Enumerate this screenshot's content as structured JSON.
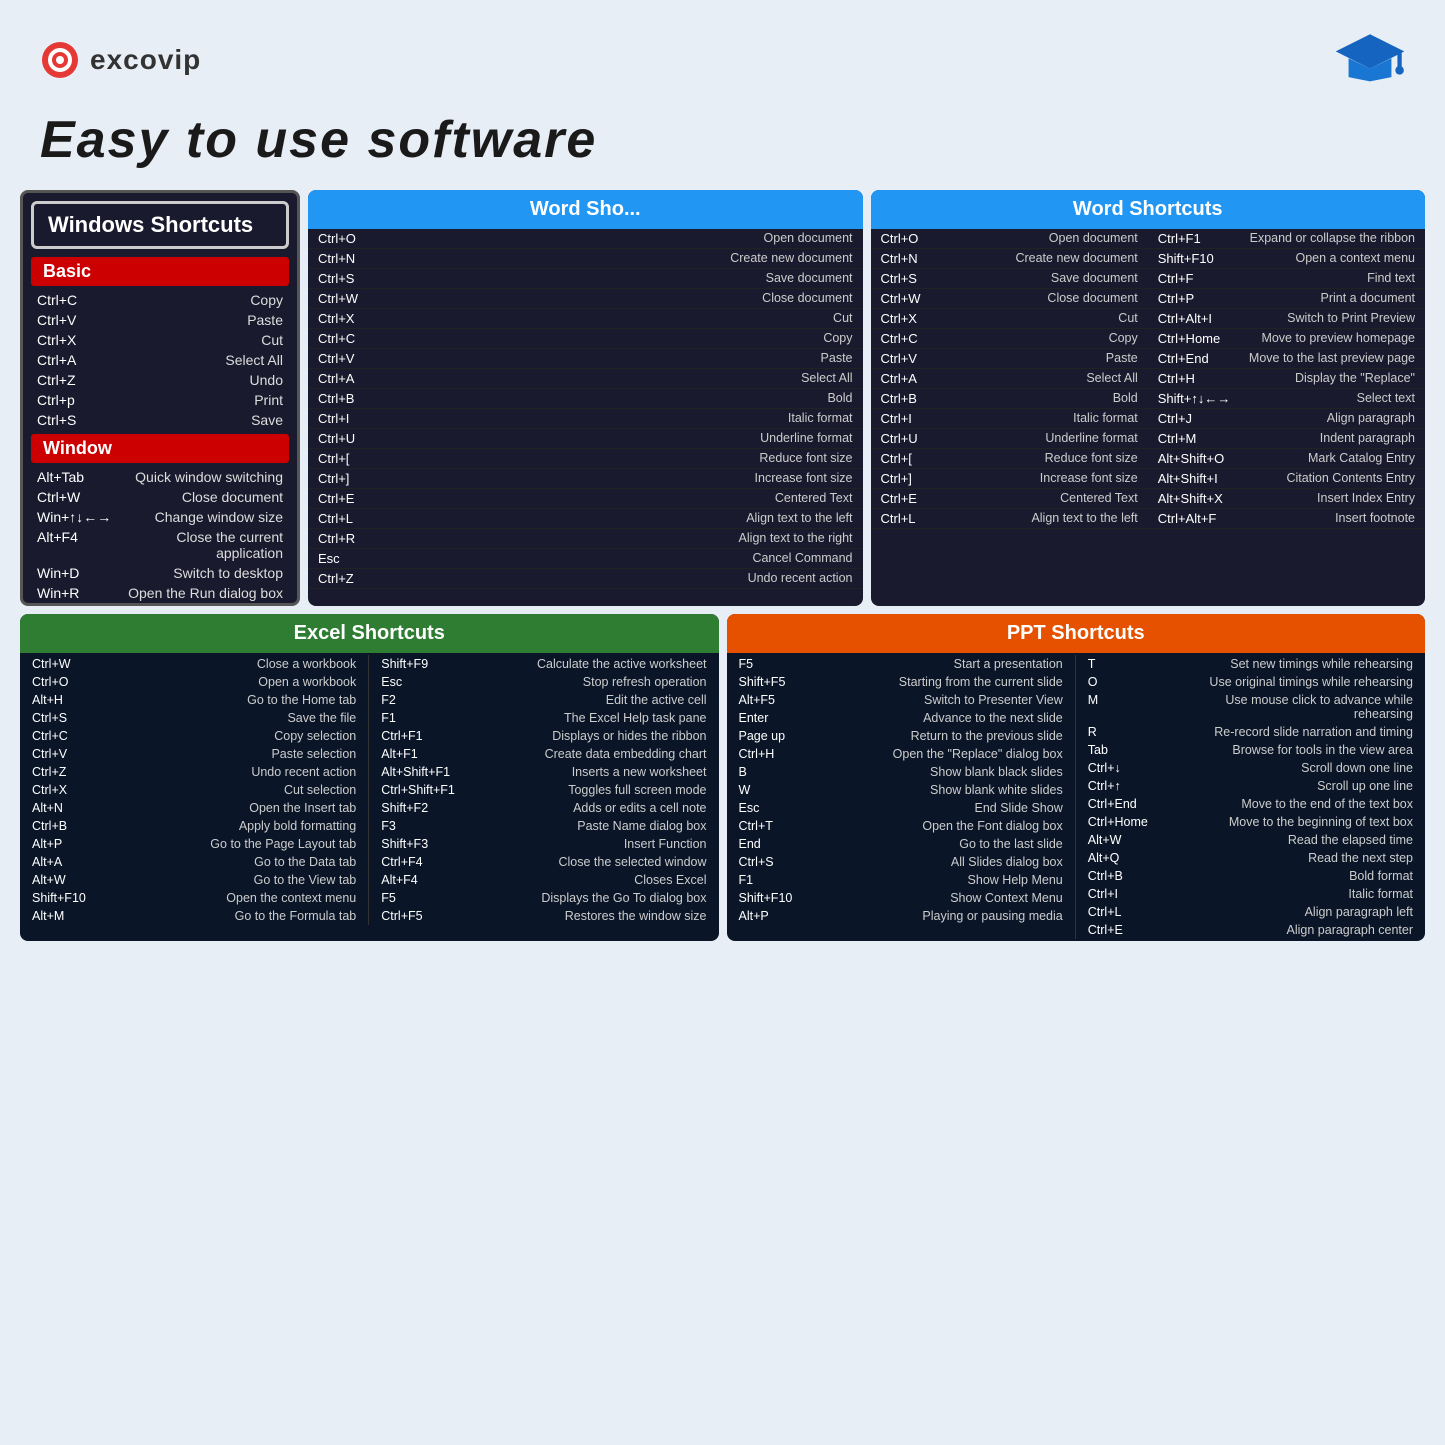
{
  "header": {
    "logo_text": "excovip",
    "tagline": "Easy to use software"
  },
  "windows": {
    "title": "Windows Shortcuts",
    "basic_label": "Basic",
    "basic_shortcuts": [
      {
        "key": "Ctrl+C",
        "desc": "Copy"
      },
      {
        "key": "Ctrl+V",
        "desc": "Paste"
      },
      {
        "key": "Ctrl+X",
        "desc": "Cut"
      },
      {
        "key": "Ctrl+A",
        "desc": "Select All"
      },
      {
        "key": "Ctrl+Z",
        "desc": "Undo"
      },
      {
        "key": "Ctrl+p",
        "desc": "Print"
      },
      {
        "key": "Ctrl+S",
        "desc": "Save"
      }
    ],
    "window_label": "Window",
    "window_shortcuts": [
      {
        "key": "Alt+Tab",
        "desc": "Quick window switching"
      },
      {
        "key": "Ctrl+W",
        "desc": "Close document"
      },
      {
        "key": "Win+↑↓←→",
        "desc": "Change window size"
      },
      {
        "key": "Alt+F4",
        "desc": "Close the current application"
      },
      {
        "key": "Win+D",
        "desc": "Switch to desktop"
      },
      {
        "key": "Win+R",
        "desc": "Open the Run dialog box"
      }
    ]
  },
  "word_left": {
    "title": "Word Sho...",
    "shortcuts": [
      {
        "key": "Ctrl+O",
        "desc": "Open document"
      },
      {
        "key": "Ctrl+N",
        "desc": "Create new document"
      },
      {
        "key": "Ctrl+S",
        "desc": "Save document"
      },
      {
        "key": "Ctrl+W",
        "desc": "Close document"
      },
      {
        "key": "Ctrl+X",
        "desc": "Cut"
      },
      {
        "key": "Ctrl+C",
        "desc": "Copy"
      },
      {
        "key": "Ctrl+V",
        "desc": "Paste"
      },
      {
        "key": "Ctrl+A",
        "desc": "Select All"
      },
      {
        "key": "Ctrl+B",
        "desc": "Bold"
      },
      {
        "key": "Ctrl+I",
        "desc": "Italic format"
      },
      {
        "key": "Ctrl+U",
        "desc": "Underline format"
      },
      {
        "key": "Ctrl+[",
        "desc": "Reduce font size"
      },
      {
        "key": "Ctrl+]",
        "desc": "Increase font size"
      },
      {
        "key": "Ctrl+E",
        "desc": "Centered Text"
      },
      {
        "key": "Ctrl+L",
        "desc": "Align text to the left"
      },
      {
        "key": "Ctrl+R",
        "desc": "Align text to the right"
      },
      {
        "key": "Esc",
        "desc": "Cancel Command"
      },
      {
        "key": "Ctrl+Z",
        "desc": "Undo recent action"
      }
    ]
  },
  "word_right": {
    "title": "Word Shortcuts",
    "col1": [
      {
        "key": "Ctrl+O",
        "desc": "Open document"
      },
      {
        "key": "Ctrl+N",
        "desc": "Create new document"
      },
      {
        "key": "Ctrl+S",
        "desc": "Save document"
      },
      {
        "key": "Ctrl+W",
        "desc": "Close document"
      },
      {
        "key": "Ctrl+X",
        "desc": "Cut"
      },
      {
        "key": "Ctrl+C",
        "desc": "Copy"
      },
      {
        "key": "Ctrl+V",
        "desc": "Paste"
      },
      {
        "key": "Ctrl+A",
        "desc": "Select All"
      },
      {
        "key": "Ctrl+B",
        "desc": "Bold"
      },
      {
        "key": "Ctrl+I",
        "desc": "Italic format"
      },
      {
        "key": "Ctrl+U",
        "desc": "Underline format"
      },
      {
        "key": "Ctrl+[",
        "desc": "Reduce font size"
      },
      {
        "key": "Ctrl+]",
        "desc": "Increase font size"
      },
      {
        "key": "Ctrl+E",
        "desc": "Centered Text"
      },
      {
        "key": "Ctrl+L",
        "desc": "Align text to the left"
      }
    ],
    "col2": [
      {
        "key": "Ctrl+F1",
        "desc": "Expand or collapse the ribbon"
      },
      {
        "key": "Shift+F10",
        "desc": "Open a context menu"
      },
      {
        "key": "Ctrl+F",
        "desc": "Find text"
      },
      {
        "key": "Ctrl+P",
        "desc": "Print a document"
      },
      {
        "key": "Ctrl+Alt+I",
        "desc": "Switch to Print Preview"
      },
      {
        "key": "Ctrl+Home",
        "desc": "Move to preview homepage"
      },
      {
        "key": "Ctrl+End",
        "desc": "Move to the last preview page"
      },
      {
        "key": "Ctrl+H",
        "desc": "Display the \"Replace\""
      },
      {
        "key": "Shift+↑↓←→",
        "desc": "Select text"
      },
      {
        "key": "Ctrl+J",
        "desc": "Align paragraph"
      },
      {
        "key": "Ctrl+M",
        "desc": "Indent paragraph"
      },
      {
        "key": "Alt+Shift+O",
        "desc": "Mark Catalog Entry"
      },
      {
        "key": "Alt+Shift+I",
        "desc": "Citation Contents Entry"
      },
      {
        "key": "Alt+Shift+X",
        "desc": "Insert Index Entry"
      },
      {
        "key": "Ctrl+Alt+F",
        "desc": "Insert footnote"
      }
    ]
  },
  "excel": {
    "title": "Excel Shortcuts",
    "col1": [
      {
        "key": "Ctrl+W",
        "desc": "Close a workbook"
      },
      {
        "key": "Ctrl+O",
        "desc": "Open a workbook"
      },
      {
        "key": "Alt+H",
        "desc": "Go to the Home tab"
      },
      {
        "key": "Ctrl+S",
        "desc": "Save the file"
      },
      {
        "key": "Ctrl+C",
        "desc": "Copy selection"
      },
      {
        "key": "Ctrl+V",
        "desc": "Paste selection"
      },
      {
        "key": "Ctrl+Z",
        "desc": "Undo recent action"
      },
      {
        "key": "Ctrl+X",
        "desc": "Cut selection"
      },
      {
        "key": "Alt+N",
        "desc": "Open the Insert tab"
      },
      {
        "key": "Ctrl+B",
        "desc": "Apply bold formatting"
      },
      {
        "key": "Alt+P",
        "desc": "Go to the Page Layout tab"
      },
      {
        "key": "Alt+A",
        "desc": "Go to the Data tab"
      },
      {
        "key": "Alt+W",
        "desc": "Go to the View tab"
      },
      {
        "key": "Shift+F10",
        "desc": "Open the context menu"
      },
      {
        "key": "Alt+M",
        "desc": "Go to the Formula tab"
      }
    ],
    "col2": [
      {
        "key": "Shift+F9",
        "desc": "Calculate the active worksheet"
      },
      {
        "key": "Esc",
        "desc": "Stop refresh operation"
      },
      {
        "key": "F2",
        "desc": "Edit the active cell"
      },
      {
        "key": "F1",
        "desc": "The Excel Help task pane"
      },
      {
        "key": "Ctrl+F1",
        "desc": "Displays or hides the ribbon"
      },
      {
        "key": "Alt+F1",
        "desc": "Create data embedding chart"
      },
      {
        "key": "Alt+Shift+F1",
        "desc": "Inserts a new worksheet"
      },
      {
        "key": "Ctrl+Shift+F1",
        "desc": "Toggles full screen mode"
      },
      {
        "key": "Shift+F2",
        "desc": "Adds or edits a cell note"
      },
      {
        "key": "F3",
        "desc": "Paste Name dialog box"
      },
      {
        "key": "Shift+F3",
        "desc": "Insert Function"
      },
      {
        "key": "Ctrl+F4",
        "desc": "Close the selected window"
      },
      {
        "key": "Alt+F4",
        "desc": "Closes Excel"
      },
      {
        "key": "F5",
        "desc": "Displays the Go To dialog box"
      },
      {
        "key": "Ctrl+F5",
        "desc": "Restores the window size"
      }
    ]
  },
  "ppt": {
    "title": "PPT Shortcuts",
    "col1": [
      {
        "key": "F5",
        "desc": "Start a presentation"
      },
      {
        "key": "Shift+F5",
        "desc": "Starting from the current slide"
      },
      {
        "key": "Alt+F5",
        "desc": "Switch to Presenter View"
      },
      {
        "key": "Enter",
        "desc": "Advance to the next slide"
      },
      {
        "key": "Page up",
        "desc": "Return to the previous slide"
      },
      {
        "key": "Ctrl+H",
        "desc": "Open the \"Replace\" dialog box"
      },
      {
        "key": "B",
        "desc": "Show blank black slides"
      },
      {
        "key": "W",
        "desc": "Show blank white slides"
      },
      {
        "key": "Esc",
        "desc": "End Slide Show"
      },
      {
        "key": "Ctrl+T",
        "desc": "Open the Font dialog box"
      },
      {
        "key": "End",
        "desc": "Go to the last slide"
      },
      {
        "key": "Ctrl+S",
        "desc": "All Slides dialog box"
      },
      {
        "key": "F1",
        "desc": "Show Help Menu"
      },
      {
        "key": "Shift+F10",
        "desc": "Show Context Menu"
      },
      {
        "key": "Alt+P",
        "desc": "Playing or pausing media"
      }
    ],
    "col2": [
      {
        "key": "T",
        "desc": "Set new timings while rehearsing"
      },
      {
        "key": "O",
        "desc": "Use original timings while rehearsing"
      },
      {
        "key": "M",
        "desc": "Use mouse click to advance while rehearsing"
      },
      {
        "key": "R",
        "desc": "Re-record slide narration and timing"
      },
      {
        "key": "Tab",
        "desc": "Browse for tools in the view area"
      },
      {
        "key": "Ctrl+↓",
        "desc": "Scroll down one line"
      },
      {
        "key": "Ctrl+↑",
        "desc": "Scroll up one line"
      },
      {
        "key": "Ctrl+End",
        "desc": "Move to the end of the text box"
      },
      {
        "key": "Ctrl+Home",
        "desc": "Move to the beginning of text box"
      },
      {
        "key": "Alt+W",
        "desc": "Read the elapsed time"
      },
      {
        "key": "Alt+Q",
        "desc": "Read the next step"
      },
      {
        "key": "Ctrl+B",
        "desc": "Bold format"
      },
      {
        "key": "Ctrl+I",
        "desc": "Italic format"
      },
      {
        "key": "Ctrl+L",
        "desc": "Align paragraph left"
      },
      {
        "key": "Ctrl+E",
        "desc": "Align paragraph center"
      }
    ]
  }
}
